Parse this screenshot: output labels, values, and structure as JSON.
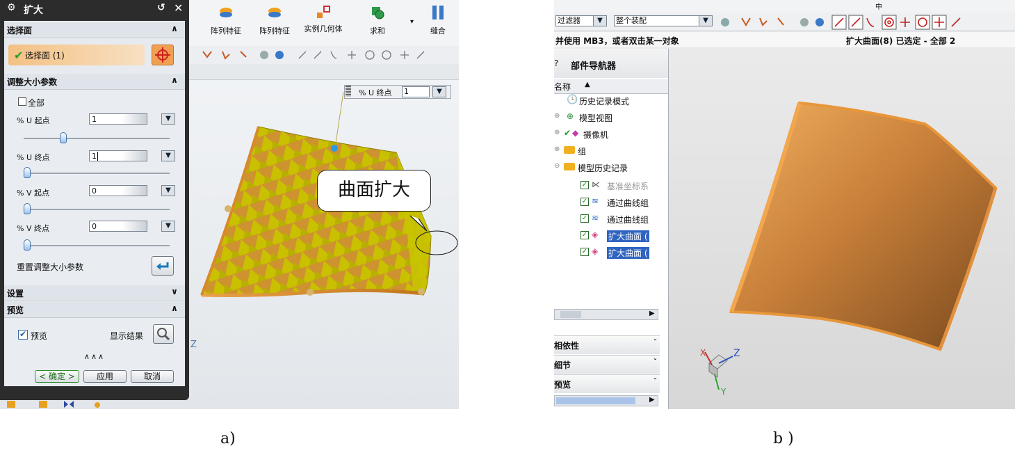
{
  "left": {
    "dialog_title": "扩大",
    "select_section": {
      "header": "选择面",
      "selection_label": "选择面 (1)"
    },
    "resize_section": {
      "header": "调整大小参数",
      "all_label": "全部",
      "u_start": {
        "label": "% U 起点",
        "value": "1",
        "slider": 0.26
      },
      "u_end": {
        "label": "% U 终点",
        "value": "1",
        "slider": 0.0
      },
      "v_start": {
        "label": "% V 起点",
        "value": "0",
        "slider": 0.0
      },
      "v_end": {
        "label": "% V 终点",
        "value": "0",
        "slider": 0.0
      },
      "reset_label": "重置调整大小参数"
    },
    "settings_header": "设置",
    "preview_section": {
      "header": "预览",
      "preview_label": "预览",
      "show_result_label": "显示结果"
    },
    "buttons": {
      "ok": "< 确定 >",
      "apply": "应用",
      "cancel": "取消"
    },
    "ribbon": [
      "阵列特征",
      "阵列特征",
      "实例几何体",
      "求和",
      "缝合"
    ],
    "u_end_callout": {
      "label": "% U 终点",
      "value": "1"
    },
    "bubble": "曲面扩大",
    "axis_label": "Z"
  },
  "right": {
    "top_strip": "中",
    "toolbar": {
      "filter": "过滤器",
      "assembly": "整个装配"
    },
    "status_left": "并使用 MB3，或者双击某一对象",
    "status_right": "扩大曲面(8) 已选定 - 全部 2",
    "navigator": {
      "title": "部件导航器",
      "column": "名称",
      "items": [
        "历史记录模式",
        "模型视图",
        "摄像机",
        "组",
        "模型历史记录",
        "基准坐标系",
        "通过曲线组",
        "通过曲线组",
        "扩大曲面 (",
        "扩大曲面 ("
      ]
    },
    "accordion": [
      "相依性",
      "细节",
      "预览"
    ],
    "axis": {
      "x": "X",
      "y": "Y",
      "z": "Z"
    }
  },
  "captions": {
    "a": "a)",
    "b": "b )"
  },
  "colors": {
    "surface_yellow": "#c8c200",
    "surface_orange": "#e89a3c",
    "selection_blue": "#2f64c0"
  }
}
